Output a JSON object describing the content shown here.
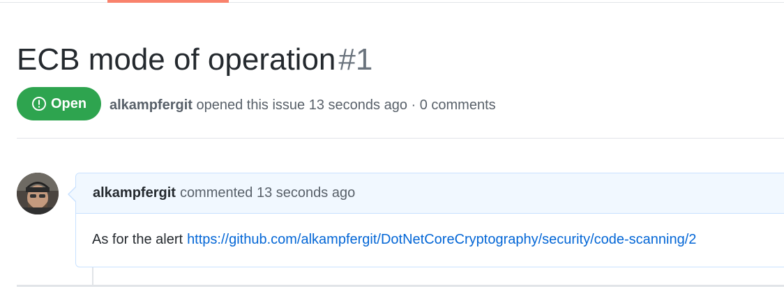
{
  "issue": {
    "title": "ECB mode of operation",
    "number": "#1",
    "state": "Open",
    "author": "alkampfergit",
    "meta_text": "opened this issue 13 seconds ago · 0 comments"
  },
  "comment": {
    "author": "alkampfergit",
    "timestamp_text": "commented 13 seconds ago",
    "body_prefix": "As for the alert",
    "link": "https://github.com/alkampfergit/DotNetCoreCryptography/security/code-scanning/2"
  },
  "icons": {
    "state": "issue-opened-icon"
  },
  "colors": {
    "open_green": "#2ea44f",
    "link_blue": "#0366d6",
    "tab_accent": "#f9826c",
    "comment_header_bg": "#f1f8ff",
    "comment_border": "#c8e1ff"
  }
}
